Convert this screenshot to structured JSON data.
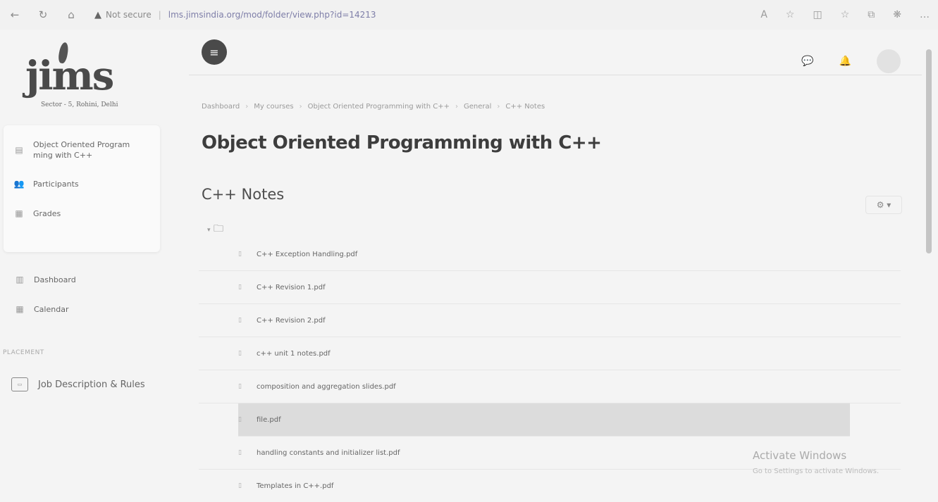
{
  "browser": {
    "security": "Not secure",
    "url": "lms.jimsindia.org/mod/folder/view.php?id=14213",
    "nav_icons": [
      "back-arrow-icon",
      "refresh-icon",
      "home-icon"
    ],
    "right_icons": [
      "read-aloud-icon",
      "favorite-star-icon",
      "split-screen-icon",
      "favorites-icon",
      "collections-icon",
      "extensions-icon",
      "more-icon"
    ]
  },
  "sidebar": {
    "logo_text": "jims",
    "logo_sub": "Sector - 5, Rohini, Delhi",
    "course_items": [
      {
        "label": "Object Oriented Program ming with C++",
        "icon": "course-icon"
      },
      {
        "label": "Participants",
        "icon": "users-icon"
      },
      {
        "label": "Grades",
        "icon": "grades-icon"
      }
    ],
    "nav_items": [
      {
        "label": "Dashboard",
        "icon": "dashboard-icon"
      },
      {
        "label": "Calendar",
        "icon": "calendar-icon"
      }
    ],
    "section_label": "PLACEMENT",
    "job_item": "Job Description & Rules"
  },
  "header": {
    "menu_icon": "menu-icon",
    "right_icons": [
      "messages-icon",
      "notifications-icon",
      "user-avatar"
    ]
  },
  "breadcrumb": [
    "Dashboard",
    "My courses",
    "Object Oriented Programming with C++",
    "General",
    "C++ Notes"
  ],
  "page_title": "Object Oriented Programming with C++",
  "folder_title": "C++ Notes",
  "files": [
    "C++ Exception Handling.pdf",
    "C++ Revision 1.pdf",
    "C++ Revision 2.pdf",
    "c++ unit 1 notes.pdf",
    "composition and aggregation slides.pdf",
    "file.pdf",
    "handling constants and initializer list.pdf",
    "Templates in C++.pdf"
  ],
  "watermark": {
    "line1": "Activate Windows",
    "line2": "Go to Settings to activate Windows."
  }
}
